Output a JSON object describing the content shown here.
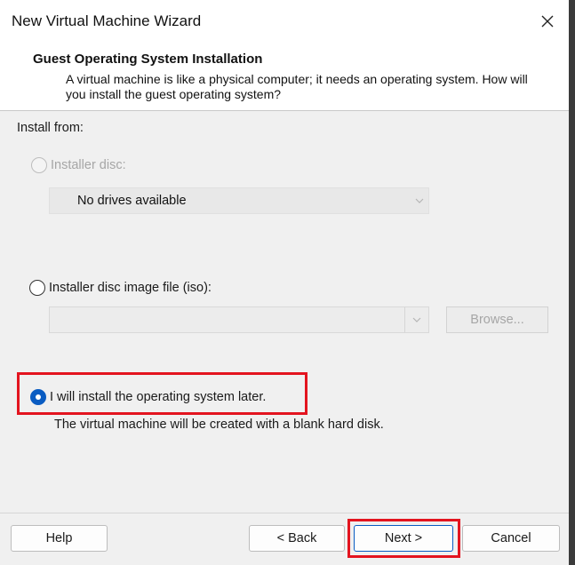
{
  "window": {
    "title": "New Virtual Machine Wizard",
    "close_icon": "close-icon"
  },
  "header": {
    "title": "Guest Operating System Installation",
    "description": "A virtual machine is like a physical computer; it needs an operating system. How will you install the guest operating system?"
  },
  "install_from": {
    "label": "Install from:",
    "options": [
      {
        "label": "Installer disc:",
        "selected": false,
        "enabled": false
      },
      {
        "label": "Installer disc image file (iso):",
        "selected": false,
        "enabled": true
      },
      {
        "label": "I will install the operating system later.",
        "selected": true,
        "enabled": true
      }
    ],
    "disc_dropdown": {
      "value": "No drives available"
    },
    "iso_combo": {
      "value": ""
    },
    "browse_label": "Browse...",
    "later_hint": "The virtual machine will be created with a blank hard disk."
  },
  "footer": {
    "help": "Help",
    "back": "< Back",
    "next": "Next >",
    "cancel": "Cancel"
  },
  "colors": {
    "accent": "#0a5cc2",
    "highlight": "#e3141f"
  }
}
